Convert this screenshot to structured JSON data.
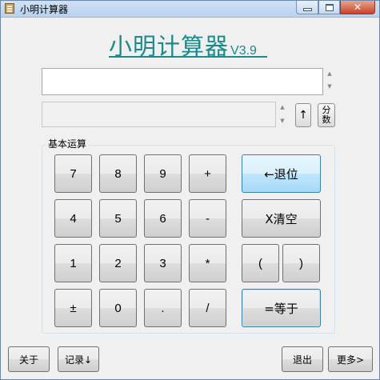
{
  "window": {
    "title": "小明计算器"
  },
  "heading": {
    "main": "小明计算器",
    "version": "V3.9"
  },
  "fields": {
    "main_value": "",
    "secondary_value": ""
  },
  "side_buttons": {
    "up": "↑",
    "fraction": "分数",
    "fraction_top": "分",
    "fraction_bottom": "数"
  },
  "group": {
    "label": "基本运算"
  },
  "keys": {
    "k7": "7",
    "k8": "8",
    "k9": "9",
    "plus": "+",
    "k4": "4",
    "k5": "5",
    "k6": "6",
    "minus": "-",
    "k1": "1",
    "k2": "2",
    "k3": "3",
    "times": "*",
    "sign": "±",
    "k0": "0",
    "dot": ".",
    "divide": "/",
    "backspace": "←退位",
    "clear": "X清空",
    "lparen": "(",
    "rparen": ")",
    "equals": "=等于"
  },
  "footer": {
    "about": "关于",
    "record": "记录↓",
    "exit": "退出",
    "more": "更多>"
  }
}
